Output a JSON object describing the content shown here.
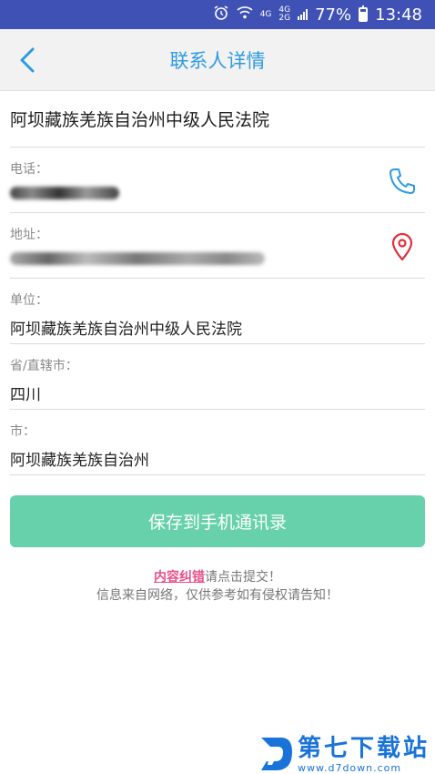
{
  "status_bar": {
    "net_top": "4G",
    "net_mid": "4G",
    "net_bot": "2G",
    "battery": "77%",
    "time": "13:48"
  },
  "header": {
    "title": "联系人详情"
  },
  "organization": "阿坝藏族羌族自治州中级人民法院",
  "fields": {
    "phone_label": "电话：",
    "address_label": "地址：",
    "unit_label": "单位：",
    "unit_value": "阿坝藏族羌族自治州中级人民法院",
    "province_label": "省/直辖市：",
    "province_value": "四川",
    "city_label": "市：",
    "city_value": "阿坝藏族羌族自治州"
  },
  "save_button": "保存到手机通讯录",
  "footer": {
    "link": "内容纠错",
    "link_suffix": "请点击提交！",
    "disclaimer": "信息来自网络，仅供参考如有侵权请告知！"
  },
  "watermark": {
    "title": "第七下载站",
    "url": "www.d7down.com"
  },
  "colors": {
    "status_bar": "#3f51b5",
    "accent": "#2e9be0",
    "save_button": "#66d1aa",
    "link": "#e8508c",
    "location_icon": "#e0303a"
  }
}
